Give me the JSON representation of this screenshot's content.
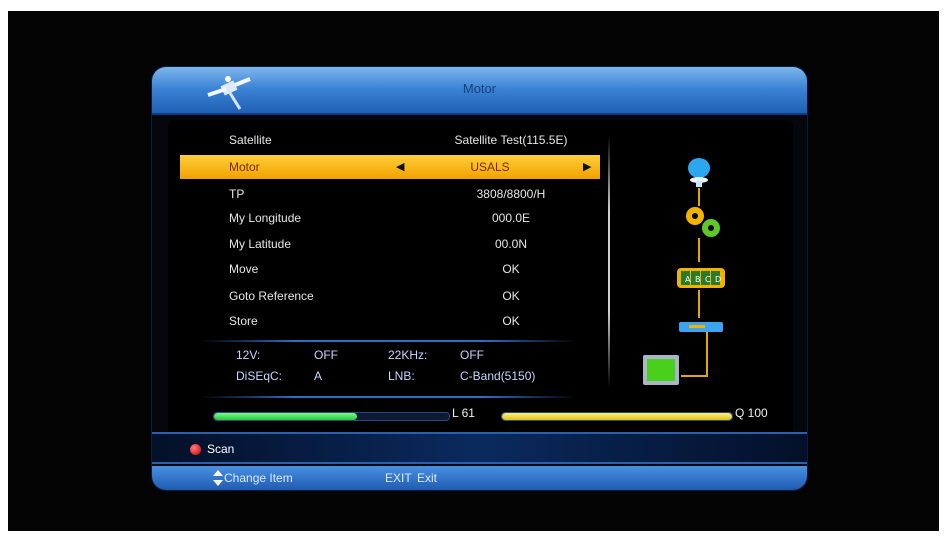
{
  "window": {
    "title": "Motor"
  },
  "menu": [
    {
      "label": "Satellite",
      "value": "Satellite Test(115.5E)"
    },
    {
      "label": "Motor",
      "value": "USALS"
    },
    {
      "label": "TP",
      "value": "3808/8800/H"
    },
    {
      "label": "My Longitude",
      "value": "000.0E"
    },
    {
      "label": "My Latitude",
      "value": "00.0N"
    },
    {
      "label": "Move",
      "value": "OK"
    },
    {
      "label": "Goto Reference",
      "value": "OK"
    },
    {
      "label": "Store",
      "value": "OK"
    }
  ],
  "status": {
    "v12_label": "12V:",
    "v12_value": "OFF",
    "khz_label": "22KHz:",
    "khz_value": "OFF",
    "diseqc_label": "DiSEqC:",
    "diseqc_value": "A",
    "lnb_label": "LNB:",
    "lnb_value": "C-Band(5150)"
  },
  "signal": {
    "level_label": "L 61",
    "level_fraction": 0.61,
    "quality_label": "Q 100",
    "quality_fraction": 1.0
  },
  "actions": {
    "scan_label": "Scan"
  },
  "hints": {
    "change_item": "Change Item",
    "exit_key": "EXIT",
    "exit_label": "Exit"
  },
  "colors": {
    "selected_row": "#f1a200",
    "title_blue": "#3d85d6",
    "level_bar": "#2ac443",
    "quality_bar": "#e0c11f"
  },
  "icons": [
    "satellite-dish-icon",
    "gears-icon",
    "diseqc-switch-icon",
    "lnb-icon",
    "tv-icon"
  ]
}
